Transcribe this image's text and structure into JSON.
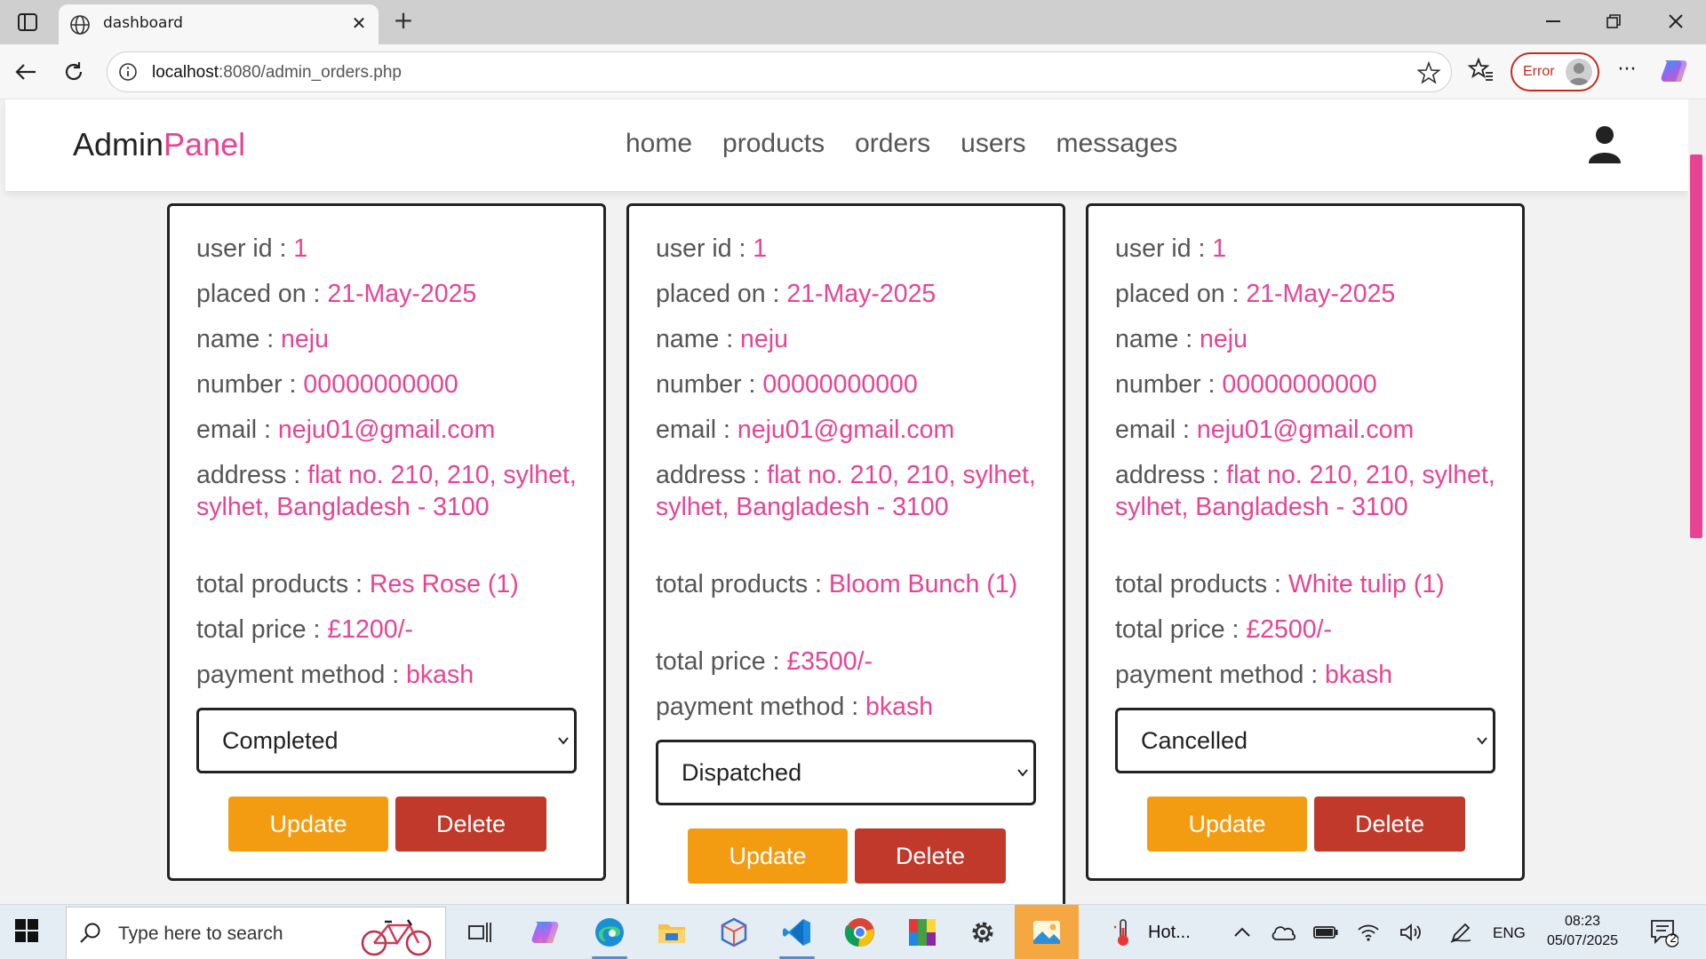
{
  "browser": {
    "tab_title": "dashboard",
    "url_host": "localhost",
    "url_path": ":8080/admin_orders.php",
    "profile_label": "Error",
    "colors": {
      "error": "#c42b1c"
    }
  },
  "header": {
    "logo_main": "Admin",
    "logo_accent": "Panel",
    "nav": [
      "home",
      "products",
      "orders",
      "users",
      "messages"
    ],
    "colors": {
      "accent": "#e84393"
    }
  },
  "labels": {
    "user_id": "user id : ",
    "placed_on": "placed on : ",
    "name": "name : ",
    "number": "number : ",
    "email": "email : ",
    "address": "address : ",
    "total_products": "total products : ",
    "total_price": "total price : ",
    "payment_method": "payment method : ",
    "update": "Update",
    "delete": "Delete"
  },
  "orders": [
    {
      "user_id": "1",
      "placed_on": "21-May-2025",
      "name": "neju",
      "number": "00000000000",
      "email": "neju01@gmail.com",
      "address": "flat no. 210, 210, sylhet, sylhet, Bangladesh - 3100",
      "total_products": "Res Rose (1)",
      "total_price": "£1200/-",
      "payment_method": "bkash",
      "status": "Completed"
    },
    {
      "user_id": "1",
      "placed_on": "21-May-2025",
      "name": "neju",
      "number": "00000000000",
      "email": "neju01@gmail.com",
      "address": "flat no. 210, 210, sylhet, sylhet, Bangladesh - 3100",
      "total_products": "Bloom Bunch (1)",
      "total_price": "£3500/-",
      "payment_method": "bkash",
      "status": "Dispatched"
    },
    {
      "user_id": "1",
      "placed_on": "21-May-2025",
      "name": "neju",
      "number": "00000000000",
      "email": "neju01@gmail.com",
      "address": "flat no. 210, 210, sylhet, sylhet, Bangladesh - 3100",
      "total_products": "White tulip (1)",
      "total_price": "£2500/-",
      "payment_method": "bkash",
      "status": "Cancelled"
    }
  ],
  "taskbar": {
    "search_placeholder": "Type here to search",
    "app_label": "Hot...",
    "language": "ENG",
    "time": "08:23",
    "date": "05/07/2025",
    "notification_count": "2"
  }
}
